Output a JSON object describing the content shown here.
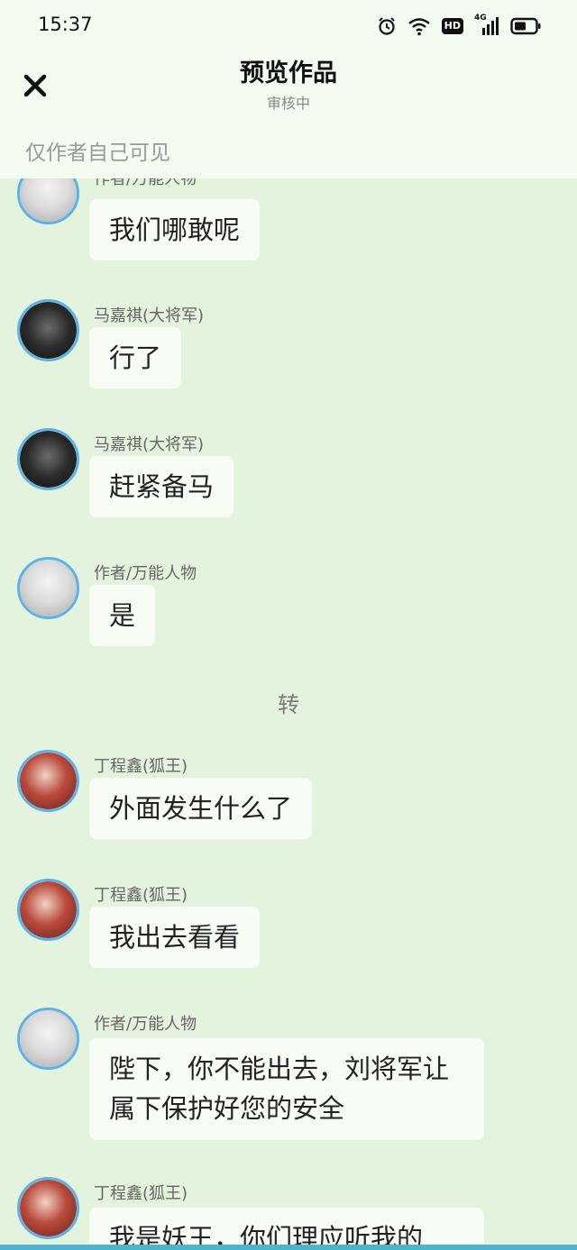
{
  "status_bar": {
    "time": "15:37",
    "icons": [
      "alarm-icon",
      "wifi-icon",
      "hd-icon",
      "signal-4g-icon",
      "battery-icon"
    ],
    "hd_label": "HD",
    "network_label": "4G"
  },
  "header": {
    "title": "预览作品",
    "subtitle": "审核中",
    "close_icon": "close-icon"
  },
  "visibility_note": "仅作者自己可见",
  "colors": {
    "background": "#e4f3dd",
    "header_bg": "#f4fbf1",
    "bubble_bg": "#f7fcf5",
    "avatar_border": "#5db2e6",
    "bottom_line": "#4fb3cf"
  },
  "messages": [
    {
      "sender": "作者/万能人物",
      "text": "我们哪敢呢"
    },
    {
      "sender": "马嘉祺(大将军)",
      "text": "行了"
    },
    {
      "sender": "马嘉祺(大将军)",
      "text": "赶紧备马"
    },
    {
      "sender": "作者/万能人物",
      "text": "是"
    },
    {
      "scene": "转"
    },
    {
      "sender": "丁程鑫(狐王)",
      "text": "外面发生什么了"
    },
    {
      "sender": "丁程鑫(狐王)",
      "text": "我出去看看"
    },
    {
      "sender": "作者/万能人物",
      "lines": [
        "陛下，你不能出去，刘将军让",
        "属下保护好您的安全"
      ]
    },
    {
      "sender": "丁程鑫(狐王)",
      "text": "我是妖王，你们理应听我的"
    }
  ]
}
